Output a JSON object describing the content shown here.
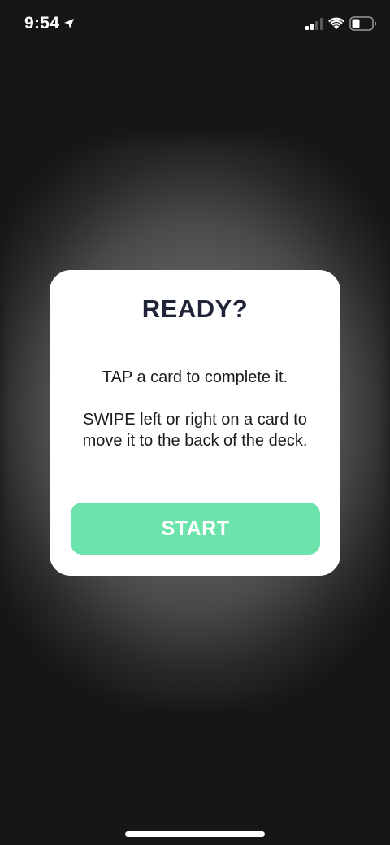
{
  "status_bar": {
    "time": "9:54",
    "icons": [
      "location-arrow-icon",
      "cellular-signal-icon",
      "wifi-icon",
      "battery-icon"
    ]
  },
  "modal": {
    "title": "READY?",
    "instruction_tap": "TAP a card to complete it.",
    "instruction_swipe": "SWIPE left or right on a card to move it to the back of the deck.",
    "start_label": "START"
  },
  "colors": {
    "background": "#161616",
    "modal_background": "#ffffff",
    "title": "#1f2439",
    "accent_button": "#6ce3aa"
  }
}
